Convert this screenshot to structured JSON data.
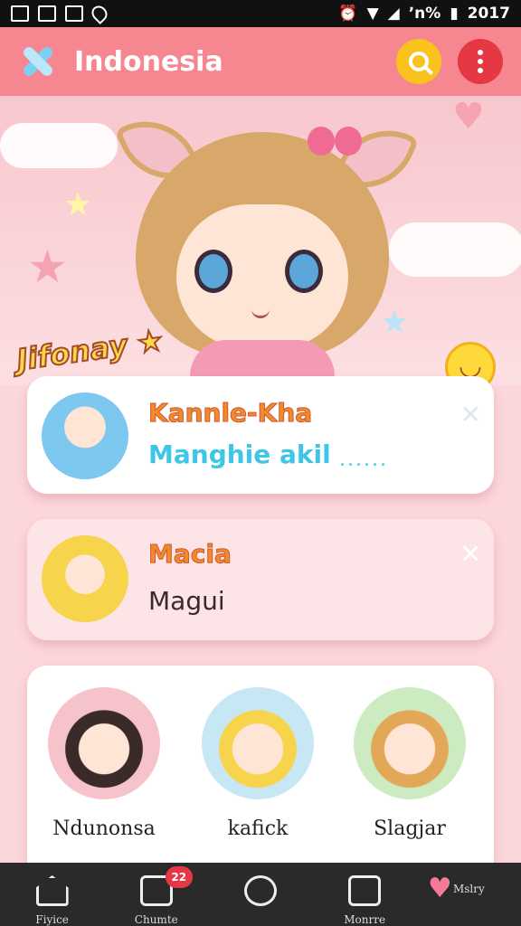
{
  "status_bar": {
    "left_icons": [
      "gallery-icon",
      "image-icon",
      "photo-icon",
      "location-icon"
    ],
    "right_icons": [
      "alarm-icon",
      "wifi-icon",
      "signal-icon",
      "battery-icon"
    ],
    "battery_text": "ʼn%",
    "time": "2017"
  },
  "app_bar": {
    "title": "Indonesia",
    "logo_icon": "app-logo-icon",
    "search_icon": "search-icon",
    "more_icon": "more-vertical-icon",
    "colors": {
      "bar": "#f6868f",
      "search": "#f9c21c",
      "more": "#e63744"
    }
  },
  "hero": {
    "tag_text": "Jifonay ★"
  },
  "cards": [
    {
      "title": "Kannle-Kha",
      "subtitle": "Manghie akil",
      "dots": "......",
      "close": "✕"
    },
    {
      "title": "Macia",
      "subtitle": "Magui",
      "close": "✕"
    }
  ],
  "grid": {
    "items": [
      {
        "label": "Ndunonsa"
      },
      {
        "label": "kafick"
      },
      {
        "label": "Slagjar"
      }
    ]
  },
  "bottom_nav": {
    "items": [
      {
        "label": "Fiyice",
        "icon": "home-icon"
      },
      {
        "label": "Chumte",
        "icon": "chat-icon",
        "badge": "22"
      },
      {
        "label": "",
        "icon": "compass-icon"
      },
      {
        "label": "Monrre",
        "icon": "square-icon"
      },
      {
        "label": "Mslry",
        "icon": "heart-icon"
      }
    ]
  }
}
